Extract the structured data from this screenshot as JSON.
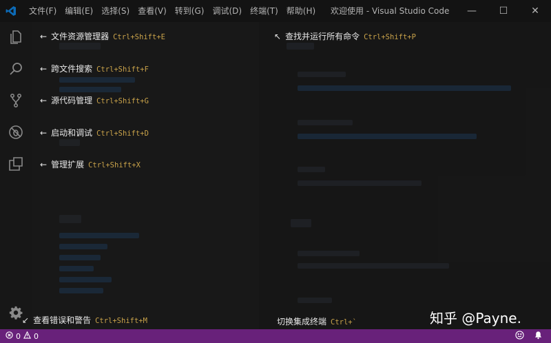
{
  "titlebar": {
    "menu": [
      "文件(F)",
      "编辑(E)",
      "选择(S)",
      "查看(V)",
      "转到(G)",
      "调试(D)",
      "终端(T)",
      "帮助(H)"
    ],
    "title": "欢迎使用 - Visual Studio Code",
    "controls": {
      "minimize": "—",
      "maximize": "☐",
      "close": "✕"
    }
  },
  "hints": {
    "explorer": {
      "label": "文件资源管理器",
      "key": "Ctrl+Shift+E"
    },
    "search": {
      "label": "跨文件搜索",
      "key": "Ctrl+Shift+F"
    },
    "scm": {
      "label": "源代码管理",
      "key": "Ctrl+Shift+G"
    },
    "debug": {
      "label": "启动和调试",
      "key": "Ctrl+Shift+D"
    },
    "extensions": {
      "label": "管理扩展",
      "key": "Ctrl+Shift+X"
    },
    "commands": {
      "label": "查找并运行所有命令",
      "key": "Ctrl+Shift+P"
    },
    "problems": {
      "label": "查看错误和警告",
      "key": "Ctrl+Shift+M"
    },
    "terminal": {
      "label": "切换集成终端",
      "key": "Ctrl+`"
    }
  },
  "statusbar": {
    "errors": "0",
    "warnings": "0"
  },
  "icons": {
    "vscode": "vscode-logo-icon",
    "explorer": "files-icon",
    "search": "search-icon",
    "scm": "source-control-icon",
    "debug": "debug-icon",
    "extensions": "extensions-icon",
    "settings": "gear-icon",
    "feedback": "smiley-icon",
    "notifications": "bell-icon"
  },
  "watermark": "知乎 @Payne.",
  "colors": {
    "statusbar": "#68217a",
    "key": "#c8a24a",
    "accent": "#0e7ad1"
  }
}
